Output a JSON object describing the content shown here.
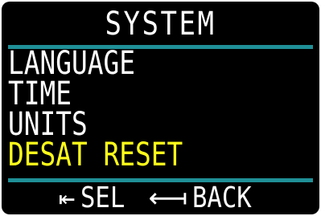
{
  "screen": {
    "title": "SYSTEM"
  },
  "menu": {
    "items": [
      {
        "label": "LANGUAGE",
        "selected": false
      },
      {
        "label": "TIME",
        "selected": false
      },
      {
        "label": "UNITS",
        "selected": false
      },
      {
        "label": "DESAT RESET",
        "selected": true
      }
    ]
  },
  "footer": {
    "select_icon": "arrow-left-short-icon",
    "select_glyph": "⇤",
    "select_label": "SEL",
    "back_icon": "arrow-left-long-icon",
    "back_glyph": "⟻",
    "back_label": "BACK"
  },
  "colors": {
    "background": "#000000",
    "text": "#ffffff",
    "selected": "#ffff1a",
    "divider": "#1f8f96"
  }
}
